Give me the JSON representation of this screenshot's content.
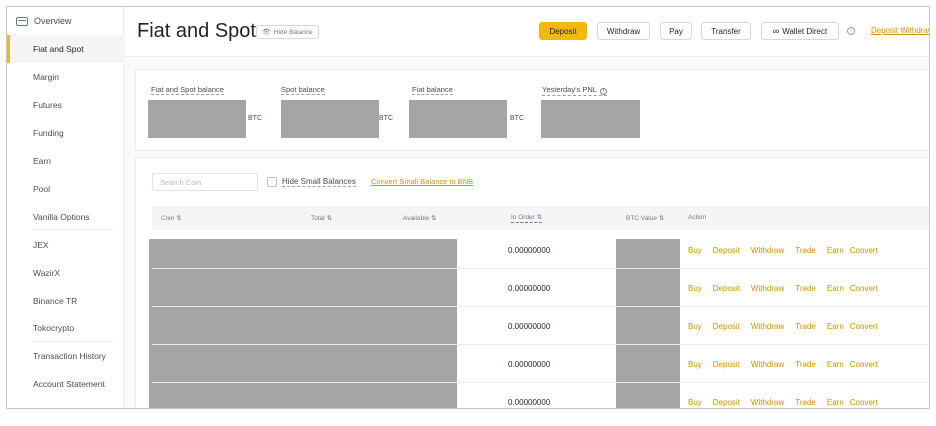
{
  "sidebar": {
    "overview": "Overview",
    "items": [
      {
        "label": "Fiat and Spot"
      },
      {
        "label": "Margin"
      },
      {
        "label": "Futures"
      },
      {
        "label": "Funding"
      },
      {
        "label": "Earn"
      },
      {
        "label": "Pool"
      },
      {
        "label": "Vanilla Options"
      },
      {
        "label": "JEX"
      },
      {
        "label": "WazirX"
      },
      {
        "label": "Binance TR"
      },
      {
        "label": "Tokocrypto"
      },
      {
        "label": "Transaction History"
      },
      {
        "label": "Account Statement"
      }
    ]
  },
  "header": {
    "title": "Fiat and Spot",
    "hide_balance": "Hide Balance",
    "deposit": "Deposit",
    "withdraw": "Withdraw",
    "pay": "Pay",
    "transfer": "Transfer",
    "wallet_direct": "Wallet Direct",
    "deposit_withdraw_link": "Deposit Withdrawal History"
  },
  "balances": {
    "fiat_spot": {
      "label": "Fiat and Spot balance",
      "unit": "BTC"
    },
    "spot": {
      "label": "Spot balance",
      "unit": "BTC"
    },
    "fiat": {
      "label": "Fiat balance",
      "unit": "BTC"
    },
    "pnl": {
      "label": "Yesterday's PNL"
    }
  },
  "filters": {
    "search_placeholder": "Search Coin",
    "hide_small": "Hide Small Balances",
    "convert_link": "Convert Small Balance to BNB"
  },
  "table": {
    "columns": {
      "coin": "Coin",
      "total": "Total",
      "available": "Available",
      "in_order": "In Order",
      "btc_value": "BTC Value",
      "action": "Action"
    },
    "rows": [
      {
        "in_order": "0.00000000"
      },
      {
        "in_order": "0.00000000"
      },
      {
        "in_order": "0.00000000"
      },
      {
        "in_order": "0.00000000"
      },
      {
        "in_order": "0.00000000"
      }
    ],
    "actions": {
      "buy": "Buy",
      "deposit": "Deposit",
      "withdraw": "Withdraw",
      "trade": "Trade",
      "earn": "Earn",
      "convert": "Convert"
    }
  },
  "colors": {
    "accent": "#f0b90b",
    "link": "#c99400",
    "redacted": "#a5a5a5"
  }
}
